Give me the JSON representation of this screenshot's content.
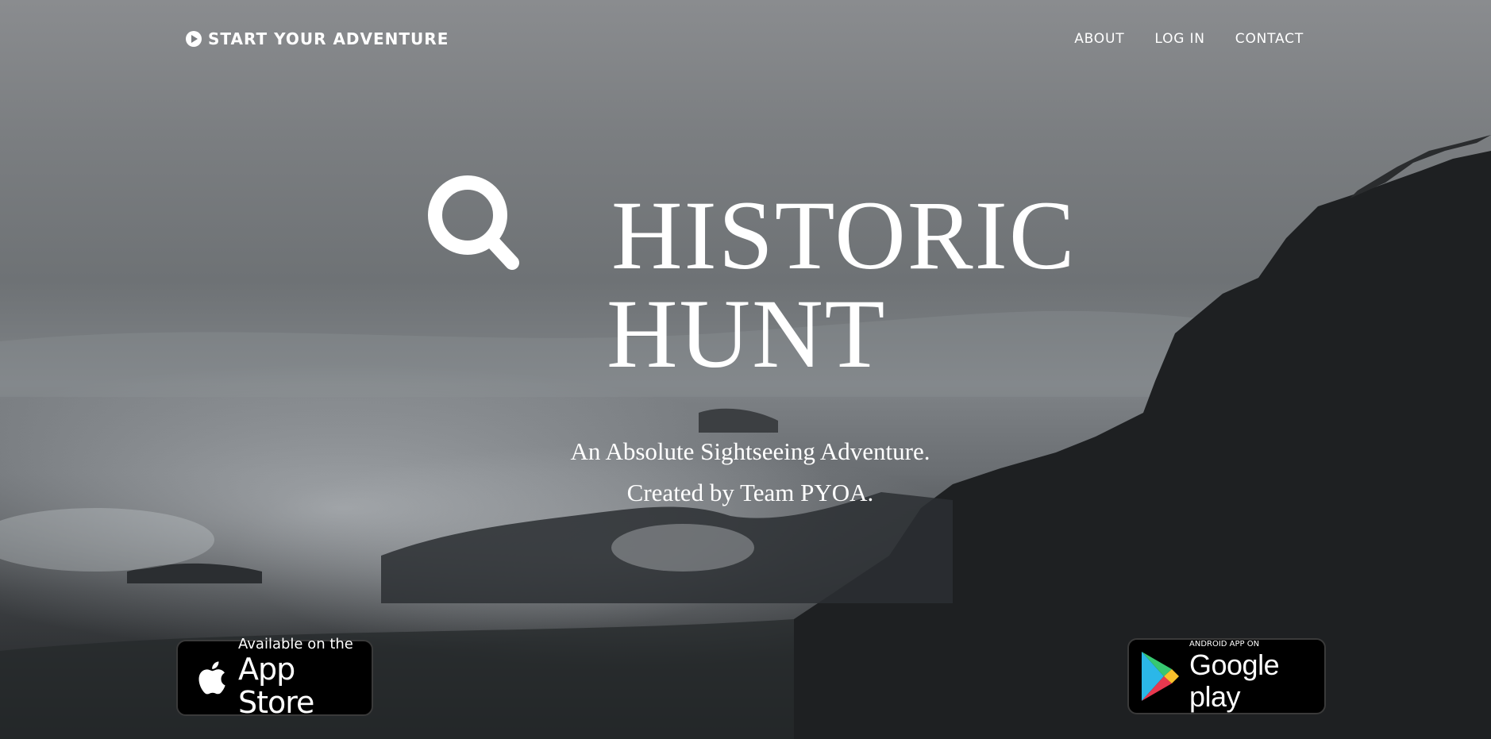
{
  "nav": {
    "brand": "START YOUR ADVENTURE",
    "links": [
      "ABOUT",
      "LOG IN",
      "CONTACT"
    ]
  },
  "hero": {
    "title_line1": "HISTORIC",
    "title_line2": "HUNT",
    "subtitle_line1": "An Absolute Sightseeing Adventure.",
    "subtitle_line2": "Created by Team PYOA.",
    "icon": "search-icon"
  },
  "badges": {
    "appstore": {
      "small": "Available on the",
      "big": "App Store",
      "icon": "apple-icon"
    },
    "googleplay": {
      "small": "ANDROID APP ON",
      "big": "Google play",
      "icon": "google-play-icon"
    }
  }
}
